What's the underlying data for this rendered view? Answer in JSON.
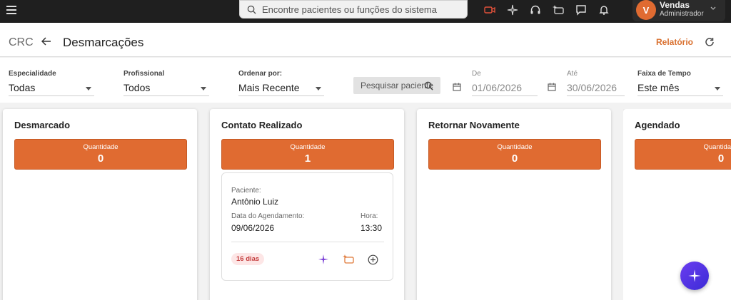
{
  "topbar": {
    "search_placeholder": "Encontre pacientes ou funções do sistema",
    "icons": [
      "video-icon",
      "sparkle-icon",
      "headset-icon",
      "chat-sparkle-icon",
      "message-icon",
      "bell-icon"
    ],
    "user": {
      "initial": "V",
      "name": "Vendas",
      "role": "Administrador"
    }
  },
  "header": {
    "breadcrumb": "CRC",
    "title": "Desmarcações",
    "report_label": "Relatório"
  },
  "filters": {
    "especialidade": {
      "label": "Especialidade",
      "value": "Todas"
    },
    "profissional": {
      "label": "Profissional",
      "value": "Todos"
    },
    "ordenar": {
      "label": "Ordenar por:",
      "value": "Mais Recente"
    },
    "search_placeholder": "Pesquisar paciente",
    "de": {
      "label": "De",
      "value": "01/06/2026"
    },
    "ate": {
      "label": "Até",
      "value": "30/06/2026"
    },
    "faixa": {
      "label": "Faixa de Tempo",
      "value": "Este mês"
    }
  },
  "columns": [
    {
      "title": "Desmarcado",
      "qty_label": "Quantidade",
      "qty": "0"
    },
    {
      "title": "Contato Realizado",
      "qty_label": "Quantidade",
      "qty": "1"
    },
    {
      "title": "Retornar Novamente",
      "qty_label": "Quantidade",
      "qty": "0"
    },
    {
      "title": "Agendado",
      "qty_label": "Quantidade",
      "qty": "0"
    }
  ],
  "card": {
    "patient_label": "Paciente:",
    "patient": "Antônio Luiz",
    "date_label": "Data do Agendamento:",
    "date": "09/06/2026",
    "time_label": "Hora:",
    "time": "13:30",
    "badge": "16 dias"
  },
  "colors": {
    "accent": "#e06b31",
    "topbar": "#1f1f1f",
    "badge_bg": "#fde6e6",
    "badge_text": "#c43e3e",
    "fab": "#4b33e0"
  }
}
